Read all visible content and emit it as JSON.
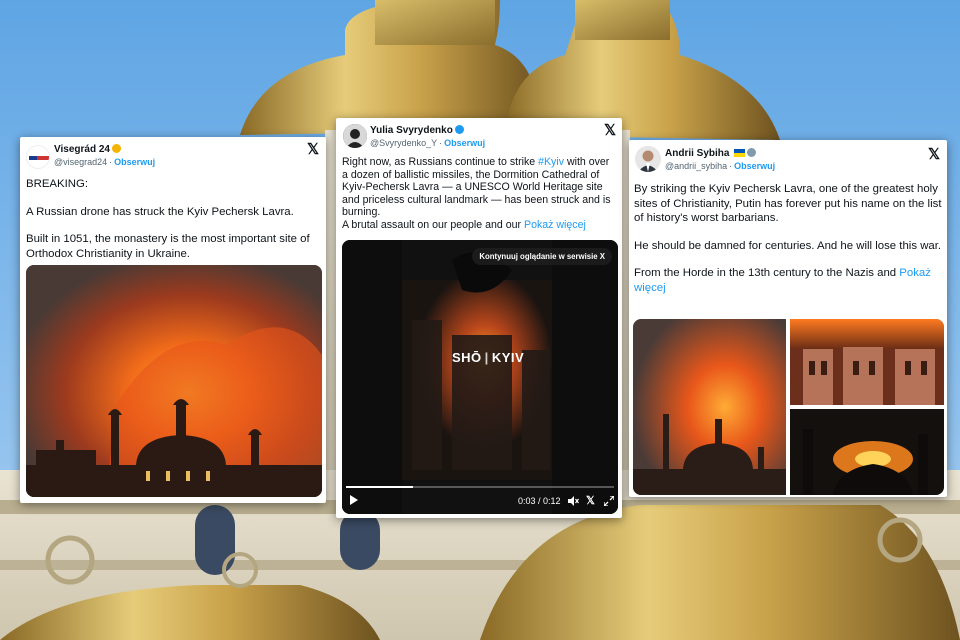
{
  "tweets": [
    {
      "author": "Visegrád 24",
      "handle": "@visegrad24",
      "follow": "Obserwuj",
      "lines": [
        "BREAKING:",
        "A Russian drone has struck the Kyiv Pechersk Lavra.",
        "Built in 1051, the monastery is the most important site of Orthodox Christianity in Ukraine."
      ]
    },
    {
      "author": "Yulia Svyrydenko",
      "handle": "@Svyrydenko_Y",
      "follow": "Obserwuj",
      "text_part1": "Right now, as Russians continue to strike ",
      "hashtag": "#Kyiv",
      "text_part2": " with over a dozen of ballistic missiles, the Dormition Cathedral of Kyiv-Pechersk Lavra — a UNESCO World Heritage site and priceless cultural landmark — has been struck and is burning.",
      "text_part3": "A brutal assault on our people and our ",
      "show_more": "Pokaż więcej",
      "video": {
        "overlay_button": "Kontynuuj oglądanie w serwisie X",
        "watermark_left": "SHŌ",
        "watermark_right": "KYIV",
        "time": "0:03 / 0:12",
        "progress": 0.25
      }
    },
    {
      "author": "Andrii Sybiha",
      "handle": "@andrii_sybiha",
      "follow": "Obserwuj",
      "para1": "By striking the Kyiv Pechersk Lavra, one of the greatest holy sites of Christianity, Putin has forever put his name on the list of history's worst barbarians.",
      "para2": "He should be damned for centuries. And he will lose this war.",
      "para3": "From the Horde in the 13th century to the Nazis and ",
      "show_more": "Pokaż więcej"
    }
  ],
  "colors": {
    "link": "#1d9bf0",
    "verified_blue": "#1d9bf0",
    "verified_gold": "#f4b400",
    "dome_gold": "#c9a24a",
    "sky": "#7fb6e6"
  }
}
